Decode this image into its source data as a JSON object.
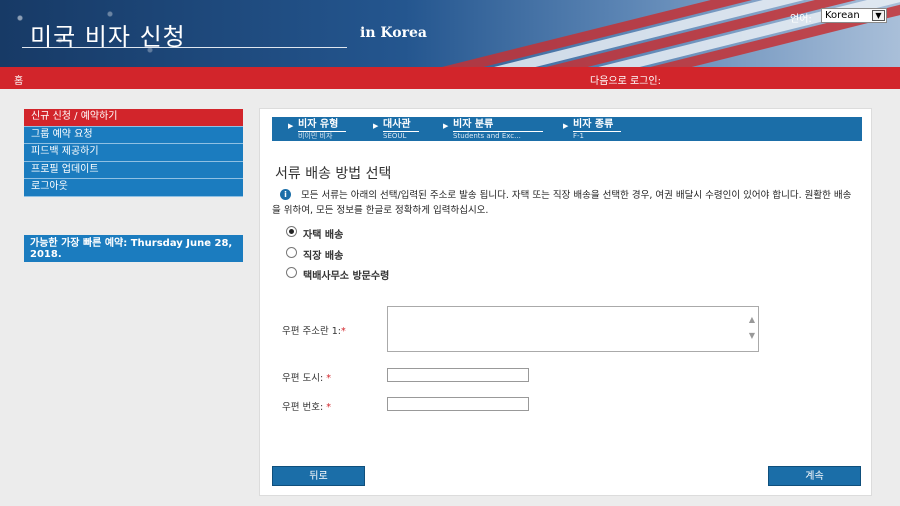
{
  "header": {
    "title": "미국 비자 신청",
    "subtitle": "in Korea",
    "language_label": "언어:",
    "language_value": "Korean"
  },
  "nav": {
    "home": "홈",
    "login_as": "다음으로 로그인:"
  },
  "sidebar": {
    "items": [
      {
        "label": "신규 신청 / 예약하기"
      },
      {
        "label": "그룹 예약 요청"
      },
      {
        "label": "피드백 제공하기"
      },
      {
        "label": "프로필 업데이트"
      },
      {
        "label": "로그아웃"
      }
    ],
    "earliest_appointment": "가능한 가장 빠른 예약: Thursday June 28, 2018."
  },
  "steps": [
    {
      "name": "비자 유형",
      "value": "비이민 비자"
    },
    {
      "name": "대사관",
      "value": "SEOUL"
    },
    {
      "name": "비자 분류",
      "value": "Students and Exc..."
    },
    {
      "name": "비자 종류",
      "value": "F-1"
    }
  ],
  "main": {
    "heading": "서류 배송 방법 선택",
    "info": "모든 서류는 아래의 선택/입력된 주소로 발송 됩니다. 자택 또는 직장 배송을 선택한 경우, 여권 배달시 수령인이 있어야 합니다. 원활한 배송을 위하여, 모든 정보를 한글로 정확하게 입력하십시오.",
    "options": [
      {
        "label": "자택 배송",
        "selected": true
      },
      {
        "label": "직장 배송",
        "selected": false
      },
      {
        "label": "택배사무소 방문수령",
        "selected": false
      }
    ],
    "fields": {
      "address_label": "우편 주소란 1:",
      "city_label": "우편 도시:",
      "zip_label": "우편 번호:",
      "required_mark": "*"
    },
    "back_button": "뒤로",
    "continue_button": "계속"
  },
  "colors": {
    "brand_red": "#d2252b",
    "brand_blue": "#1b7cbf"
  }
}
